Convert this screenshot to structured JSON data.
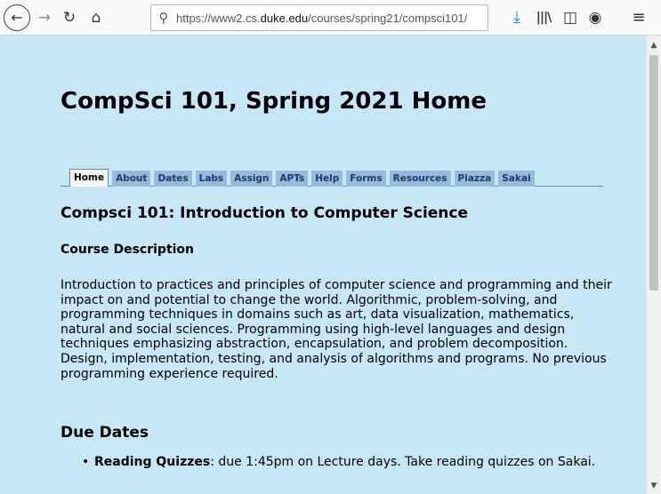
{
  "browser": {
    "url_prefix": "https://www2.cs.",
    "url_domain": "duke.edu",
    "url_path": "/courses/spring21/compsci101/",
    "icons": {
      "back": "back-arrow-icon",
      "forward": "forward-arrow-icon",
      "reload": "reload-icon",
      "home": "home-icon",
      "search": "search-icon",
      "download": "download-icon",
      "library": "library-icon",
      "sidebar": "sidebar-icon",
      "account": "account-icon",
      "menu": "menu-icon"
    }
  },
  "page": {
    "title": "CompSci 101, Spring 2021 Home",
    "tabs": [
      "Home",
      "About",
      "Dates",
      "Labs",
      "Assign",
      "APTs",
      "Help",
      "Forms",
      "Resources",
      "Piazza",
      "Sakai"
    ],
    "active_tab": "Home",
    "course_heading": "Compsci 101: Introduction to Computer Science",
    "description_heading": "Course Description",
    "description": "Introduction to practices and principles of computer science and programming and their impact on and potential to change the world. Algorithmic, problem-solving, and programming techniques in domains such as art, data visualization, mathematics, natural and social sciences. Programming using high-level languages and design techniques emphasizing abstraction, encapsulation, and problem decomposition. Design, implementation, testing, and analysis of algorithms and programs. No previous programming experience required.",
    "due_heading": "Due Dates",
    "due_items": [
      {
        "label": "Reading Quizzes",
        "text": ": due 1:45pm on Lecture days. Take reading quizzes on Sakai."
      }
    ]
  },
  "colors": {
    "page_background": "#c7e6f6",
    "tab_background": "#95bcd8",
    "tab_text": "#1a3c6e",
    "download_accent": "#0a84ff"
  }
}
